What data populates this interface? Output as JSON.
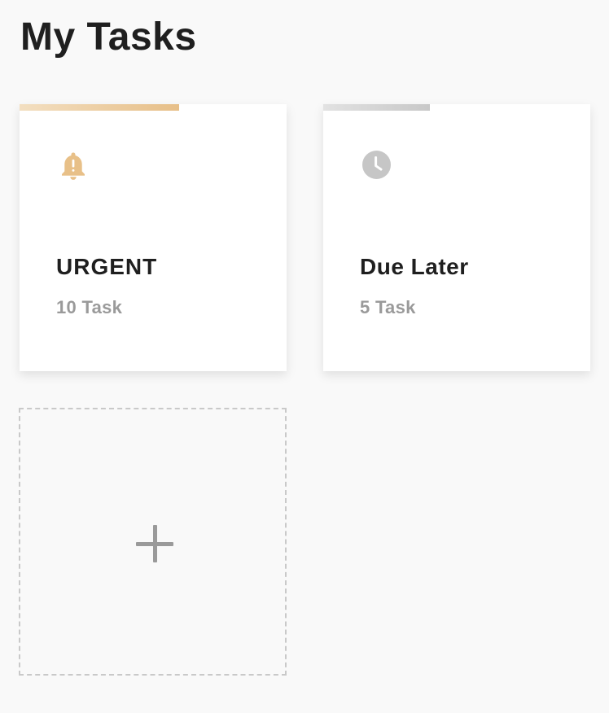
{
  "header": {
    "title": "My Tasks"
  },
  "cards": [
    {
      "title": "URGENT",
      "count_label": "10 Task",
      "icon": "bell-alert-icon",
      "accent_color": "#e7bf88",
      "progress": 0.6
    },
    {
      "title": "Due Later",
      "count_label": "5 Task",
      "icon": "clock-icon",
      "accent_color": "#c8c8c8",
      "progress": 0.4
    }
  ],
  "add_card": {
    "icon": "plus-icon"
  }
}
